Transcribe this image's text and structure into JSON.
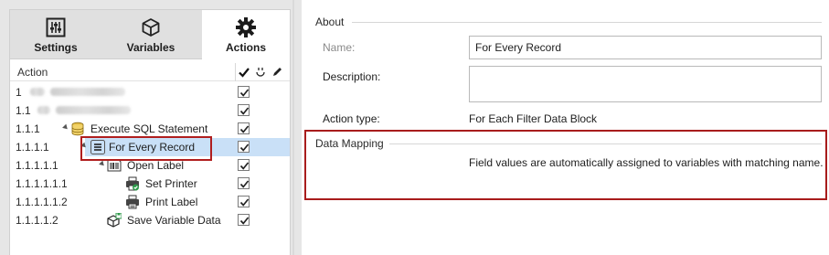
{
  "tabs": [
    {
      "label": "Settings",
      "icon": "sliders-icon"
    },
    {
      "label": "Variables",
      "icon": "cube-icon"
    },
    {
      "label": "Actions",
      "icon": "gear-icon",
      "active": true
    }
  ],
  "tree_header": {
    "action": "Action",
    "col_enabled_icon": "checkmark-icon",
    "col_run_icon": "lightning-icon",
    "col_edit_icon": "pencil-icon"
  },
  "tree_rows": [
    {
      "num": "1",
      "label": "",
      "blurred": true,
      "icon": "blurred-icon",
      "checked": true
    },
    {
      "num": "1.1",
      "label": "",
      "blurred": true,
      "icon": "blurred-icon",
      "checked": true
    },
    {
      "num": "1.1.1",
      "label": "Execute SQL Statement",
      "icon": "database-icon",
      "checked": true
    },
    {
      "num": "1.1.1.1",
      "label": "For Every Record",
      "icon": "list-icon",
      "checked": true,
      "selected": true
    },
    {
      "num": "1.1.1.1.1",
      "label": "Open Label",
      "icon": "barcode-label-icon",
      "checked": true
    },
    {
      "num": "1.1.1.1.1.1",
      "label": "Set Printer",
      "icon": "printer-check-icon",
      "checked": true
    },
    {
      "num": "1.1.1.1.1.2",
      "label": "Print Label",
      "icon": "printer-icon",
      "checked": true
    },
    {
      "num": "1.1.1.1.2",
      "label": "Save Variable Data",
      "icon": "save-data-icon",
      "checked": true
    }
  ],
  "about": {
    "title": "About",
    "name_label": "Name:",
    "name_value": "For Every Record",
    "description_label": "Description:",
    "description_value": "",
    "action_type_label": "Action type:",
    "action_type_value": "For Each Filter Data Block"
  },
  "data_mapping": {
    "title": "Data Mapping",
    "text": "Field values are automatically assigned to variables with matching name."
  },
  "colors": {
    "selection": "#c9e0f7",
    "highlight_border": "#b01e1e",
    "tab_strip": "#e0e0e0"
  }
}
